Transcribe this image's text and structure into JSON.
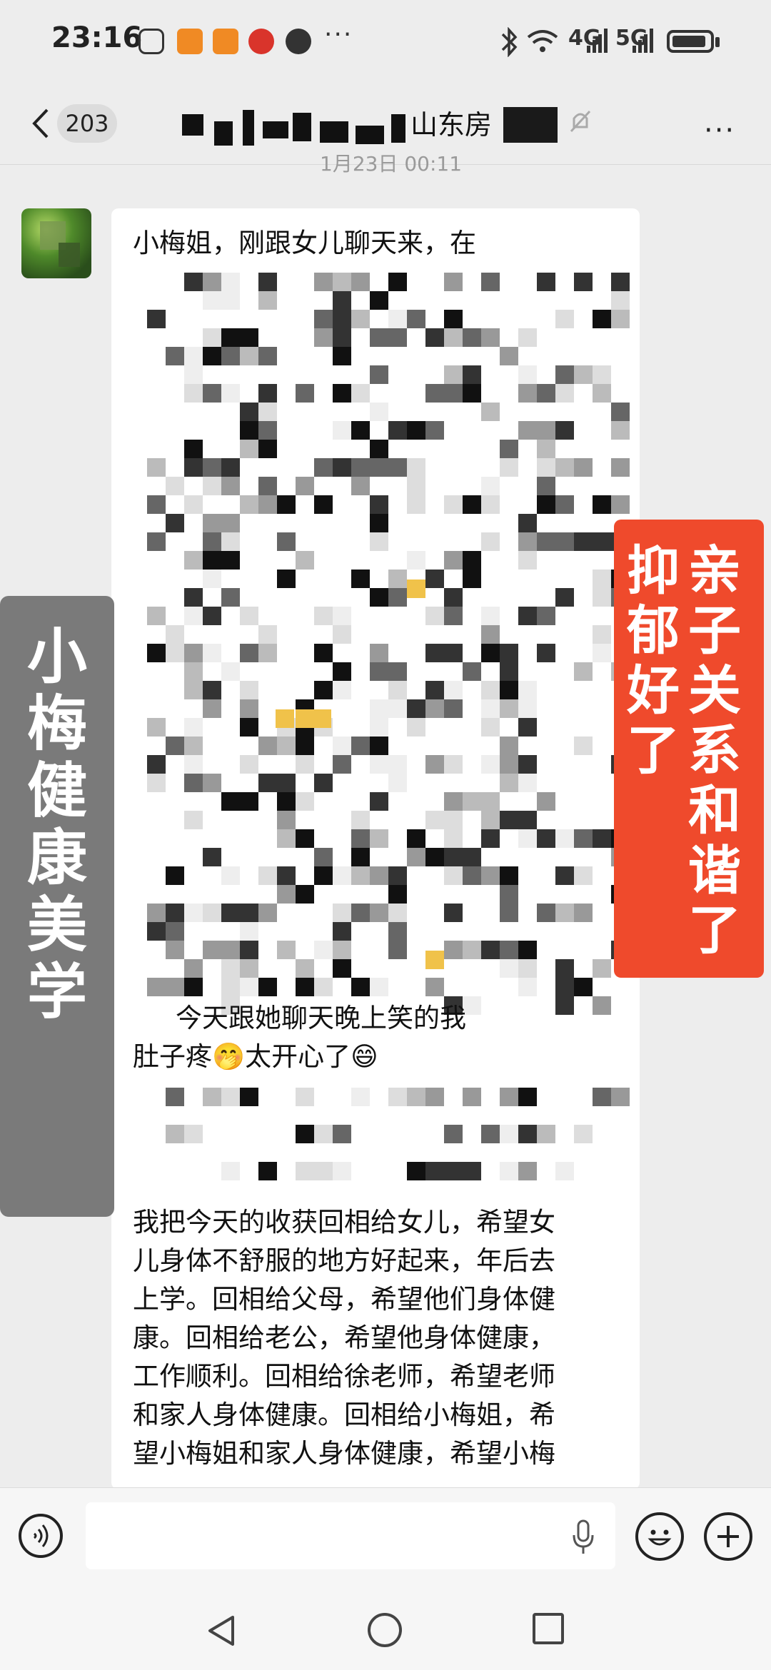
{
  "status_bar": {
    "time": "23:16",
    "network_4g": "4G",
    "network_5g": "5G",
    "more": "···"
  },
  "header": {
    "back_count": "203",
    "title": "山东房",
    "more": "···",
    "timestamp": "1月23日 00:11"
  },
  "message": {
    "line1": "小梅姐，刚跟女儿聊天来，在",
    "line2": "今天跟她聊天晚上笑的我",
    "line3": "肚子疼🤭太开心了😄",
    "para": [
      "我把今天的收获回相给女儿，希望女",
      "儿身体不舒服的地方好起来，年后去",
      "上学。回相给父母，希望他们身体健",
      "康。回相给老公，希望他身体健康，",
      "工作顺利。回相给徐老师，希望老师",
      "和家人身体健康。回相给小梅姐，希",
      "望小梅姐和家人身体健康，希望小梅"
    ]
  },
  "overlays": {
    "left_text": "小梅健康美学",
    "right_col1": "亲子关系和谐了",
    "right_col2": "抑郁好了"
  },
  "icons": {
    "back": "chevron-left-icon",
    "mute": "mute-bell-icon",
    "voice": "voice-icon",
    "mic": "mic-icon",
    "emoji": "emoji-icon",
    "add": "plus-icon"
  }
}
